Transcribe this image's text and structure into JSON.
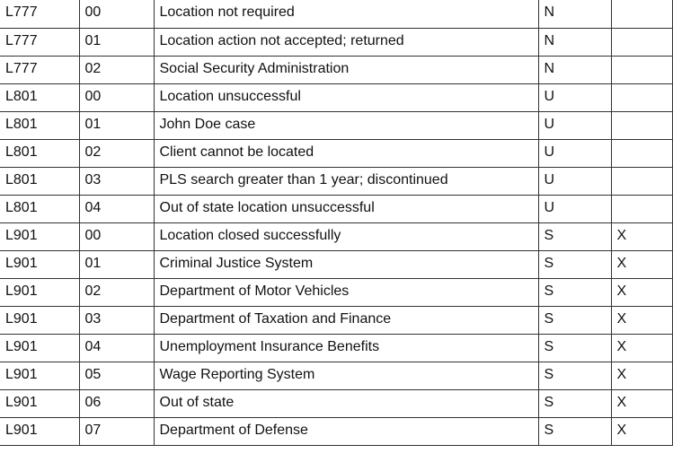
{
  "table": {
    "rows": [
      {
        "code": "L777",
        "sub": "00",
        "description": "Location not required",
        "status": "N",
        "flag": ""
      },
      {
        "code": "L777",
        "sub": "01",
        "description": "Location action not accepted; returned",
        "status": "N",
        "flag": ""
      },
      {
        "code": "L777",
        "sub": "02",
        "description": "Social Security Administration",
        "status": "N",
        "flag": ""
      },
      {
        "code": "L801",
        "sub": "00",
        "description": "Location unsuccessful",
        "status": "U",
        "flag": ""
      },
      {
        "code": "L801",
        "sub": "01",
        "description": "John Doe case",
        "status": "U",
        "flag": ""
      },
      {
        "code": "L801",
        "sub": "02",
        "description": "Client cannot be located",
        "status": "U",
        "flag": ""
      },
      {
        "code": "L801",
        "sub": "03",
        "description": "PLS search greater than 1 year; discontinued",
        "status": "U",
        "flag": ""
      },
      {
        "code": "L801",
        "sub": "04",
        "description": "Out of state location unsuccessful",
        "status": "U",
        "flag": ""
      },
      {
        "code": "L901",
        "sub": "00",
        "description": "Location closed successfully",
        "status": "S",
        "flag": "X"
      },
      {
        "code": "L901",
        "sub": "01",
        "description": "Criminal Justice System",
        "status": "S",
        "flag": "X"
      },
      {
        "code": "L901",
        "sub": "02",
        "description": "Department of Motor Vehicles",
        "status": "S",
        "flag": "X"
      },
      {
        "code": "L901",
        "sub": "03",
        "description": "Department of Taxation and Finance",
        "status": "S",
        "flag": "X"
      },
      {
        "code": "L901",
        "sub": "04",
        "description": "Unemployment Insurance Benefits",
        "status": "S",
        "flag": "X"
      },
      {
        "code": "L901",
        "sub": "05",
        "description": "Wage Reporting System",
        "status": "S",
        "flag": "X"
      },
      {
        "code": "L901",
        "sub": "06",
        "description": "Out of state",
        "status": "S",
        "flag": "X"
      },
      {
        "code": "L901",
        "sub": "07",
        "description": "Department of Defense",
        "status": "S",
        "flag": "X"
      }
    ]
  }
}
